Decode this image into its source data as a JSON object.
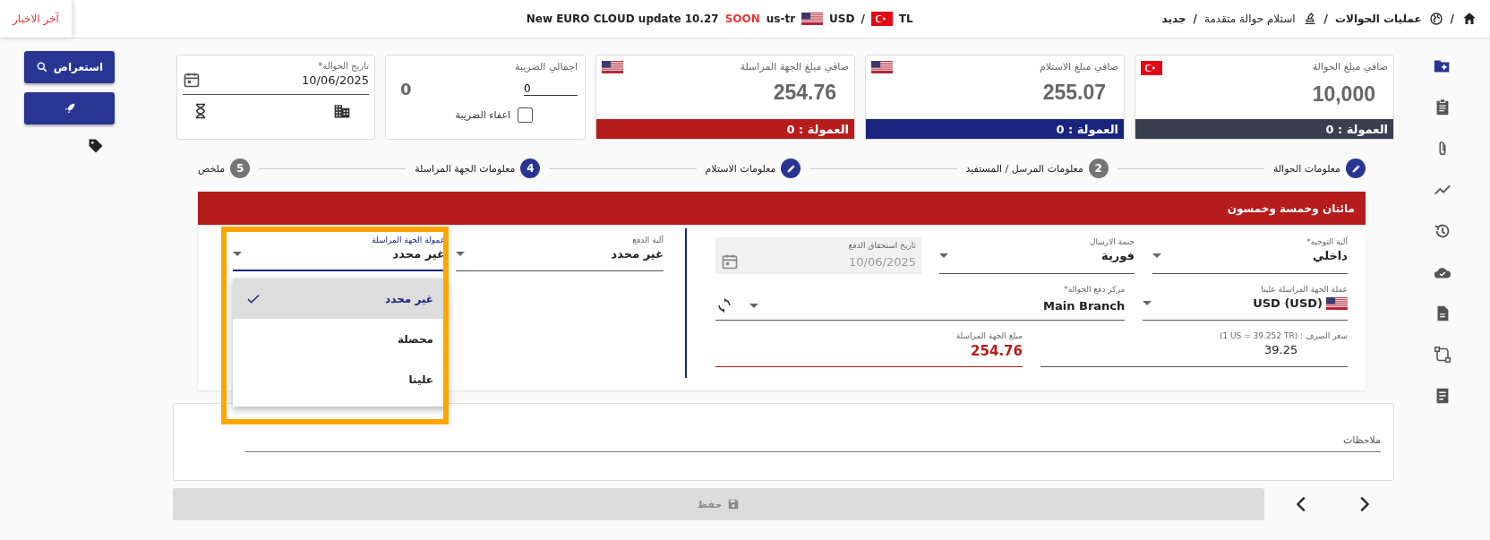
{
  "topbar": {
    "breadcrumb": [
      {
        "separator": "/",
        "label": "عمليات الحوالات",
        "bold": true
      },
      {
        "separator": "/",
        "label": "استلام حوالة متقدمة",
        "bold": false
      },
      {
        "separator": "/",
        "label": "جديد",
        "bold": true
      }
    ],
    "ticker": {
      "text": "New EURO CLOUD update 10.27",
      "badge": "SOON",
      "locale": "us-tr",
      "from_flag": {
        "kind": "us"
      },
      "from": "USD",
      "separator": "/",
      "to_flag": {
        "kind": "tr"
      },
      "to": "TL"
    },
    "news_button": "آخر الاخبار"
  },
  "actions": {
    "preview_button": "استعراض"
  },
  "amounts": [
    {
      "label": "صافي مبلغ الحوالة",
      "flag": {
        "kind": "tr"
      },
      "value": "10,000",
      "commission": "العمولة : 0",
      "color": "#3a3f4f"
    },
    {
      "label": "صافي مبلغ الاستلام",
      "flag": {
        "kind": "us"
      },
      "value": "255.07",
      "commission": "العمولة : 0",
      "color": "#1a237e"
    },
    {
      "label": "صافي مبلغ الجهة المراسلة",
      "flag": {
        "kind": "us"
      },
      "value": "254.76",
      "commission": "العمولة : 0",
      "color": "#b71c1c"
    }
  ],
  "tax": {
    "label": "اجمالي الضريبة",
    "input": "0",
    "total": "0",
    "exempt_label": "اعفاء الضريبة",
    "checked": false
  },
  "date_card": {
    "label": "تاريخ الحوالة*",
    "value": "10/06/2025"
  },
  "steps": [
    {
      "label": "معلومات الحوالة",
      "kind": "done"
    },
    {
      "label": "معلومات المرسل / المستفيد",
      "kind": "pending",
      "number": "2"
    },
    {
      "label": "معلومات الاستلام",
      "kind": "done"
    },
    {
      "label": "معلومات الجهة المراسلة",
      "kind": "current",
      "number": "4"
    },
    {
      "label": "ملخص",
      "kind": "pending",
      "number": "5"
    }
  ],
  "form": {
    "title": "مائتان وخمسة وخمسون",
    "right_rows": [
      [
        {
          "kind": "select",
          "label": "آلية التوجيه*",
          "value": "داخلي"
        },
        {
          "kind": "select",
          "label": "حنمة الارسال",
          "value": "فورية"
        },
        {
          "kind": "date",
          "label": "تاريخ استحقاق الدفع",
          "value": "10/06/2025",
          "disabled": true
        }
      ],
      [
        {
          "kind": "currency",
          "label": "عملة الجهة المراسلة علينا",
          "value": "USD (USD)",
          "flag": {
            "kind": "us"
          }
        },
        {
          "kind": "branch",
          "label": "مركز دفع الحوالة*",
          "value": "Main Branch"
        }
      ],
      [
        {
          "kind": "text",
          "label": "(1 US = 39.252 TR) : سعر الصرف",
          "value": "39.25"
        },
        {
          "kind": "amount",
          "label": "مبلغ الجهة المراسلة",
          "value": "254.76"
        }
      ]
    ],
    "left_fields": [
      {
        "kind": "select",
        "label": "آلية الدفع",
        "value": "غير محدد",
        "open": false
      },
      {
        "kind": "select",
        "label": "عمولة الجهة المراسلة",
        "value": "غير محدد",
        "open": true,
        "options": [
          {
            "label": "غير محدد",
            "selected": true
          },
          {
            "label": "محصلة",
            "selected": false
          },
          {
            "label": "علينا",
            "selected": false
          }
        ]
      }
    ]
  },
  "notes": {
    "placeholder": "ملاحظات"
  },
  "save_button": {
    "label": "حفظ",
    "disabled": true
  }
}
